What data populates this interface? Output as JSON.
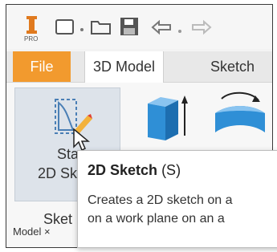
{
  "ribbon": {
    "tabs": [
      {
        "label": "File"
      },
      {
        "label": "3D Model"
      },
      {
        "label": "Sketch"
      }
    ],
    "start_sketch_line1": "Sta",
    "start_sketch_line2": "2D Sk",
    "panel_label_partial": "Sket",
    "panel_title": "Model ×"
  },
  "tooltip": {
    "title": "2D Sketch",
    "shortcut": "(S)",
    "desc_line1": "Creates a 2D sketch on a",
    "desc_line2": "on a work plane on an a"
  },
  "colors": {
    "file_tab": "#f29a2e",
    "extrude_blue": "#2f8fd6",
    "highlight": "#dde3ea"
  },
  "icons": [
    "inventor-logo-icon",
    "new-file-icon",
    "open-folder-icon",
    "save-icon",
    "undo-icon",
    "redo-icon",
    "start-2d-sketch-icon",
    "extrude-icon",
    "revolve-icon",
    "mouse-cursor-icon"
  ]
}
